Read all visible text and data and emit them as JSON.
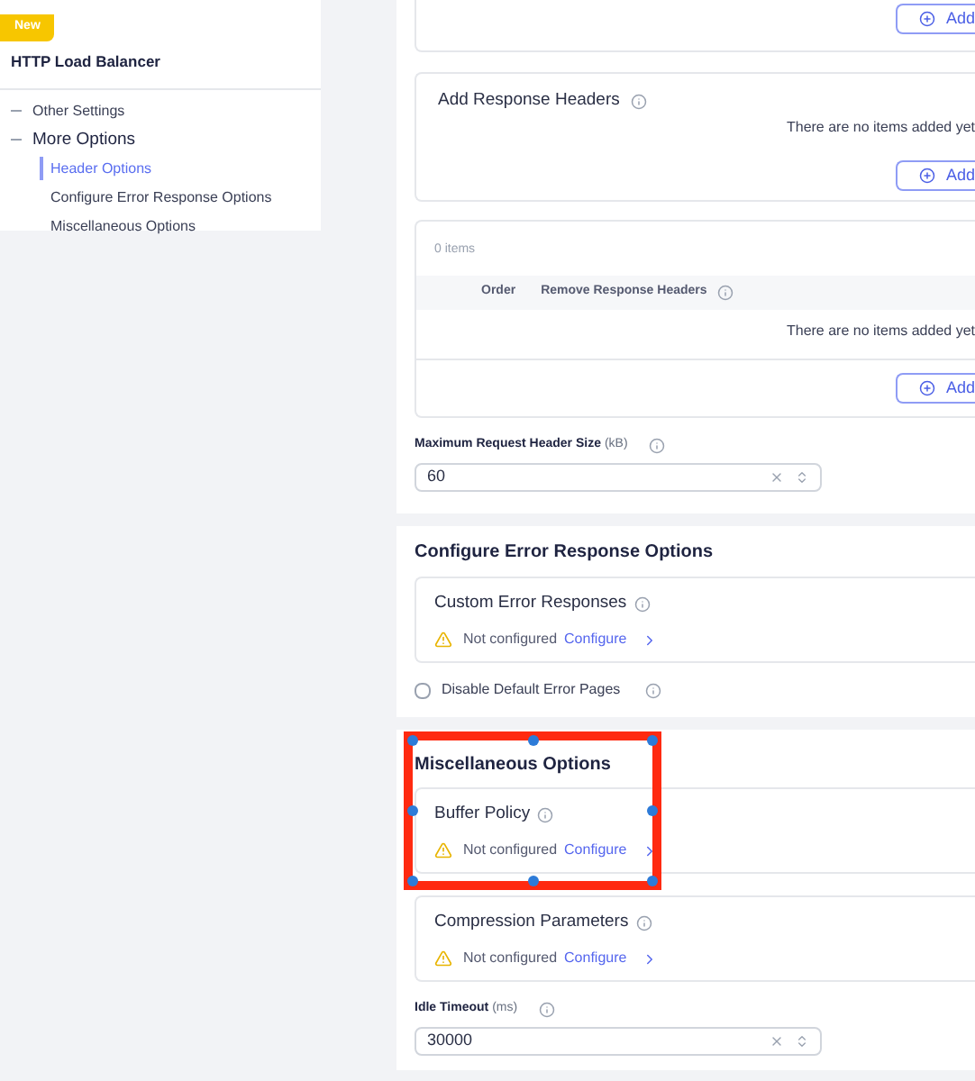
{
  "sidebar": {
    "badge": "New",
    "title": "HTTP Load Balancer",
    "tree": [
      {
        "label": "Other Settings",
        "selected": false
      },
      {
        "label": "More Options",
        "selected": false,
        "children": [
          {
            "label": "Header Options",
            "selected": true
          },
          {
            "label": "Configure Error Response Options",
            "selected": false
          },
          {
            "label": "Miscellaneous Options",
            "selected": false
          }
        ]
      }
    ]
  },
  "header_section": {
    "top_add_button": "Add",
    "add_response_headers": {
      "title": "Add Response Headers",
      "empty_text": "There are no items added yet",
      "add_button": "Add"
    },
    "remove_table": {
      "count": "0 items",
      "columns": [
        "Order",
        "Remove Response Headers"
      ],
      "empty_text": "There are no items added yet",
      "add_button": "Add"
    },
    "max_header_size": {
      "label": "Maximum Request Header Size",
      "unit": "(kB)",
      "value": "60"
    }
  },
  "error_section": {
    "title": "Configure Error Response Options",
    "cards": [
      {
        "title": "Custom Error Responses",
        "status": "Not configured",
        "link": "Configure"
      }
    ],
    "checkbox": {
      "label": "Disable Default Error Pages",
      "checked": false
    }
  },
  "misc_section": {
    "title": "Miscellaneous Options",
    "cards": [
      {
        "title": "Buffer Policy",
        "status": "Not configured",
        "link": "Configure"
      },
      {
        "title": "Compression Parameters",
        "status": "Not configured",
        "link": "Configure"
      }
    ],
    "idle_timeout": {
      "label": "Idle Timeout",
      "unit": "(ms)",
      "value": "30000"
    }
  }
}
